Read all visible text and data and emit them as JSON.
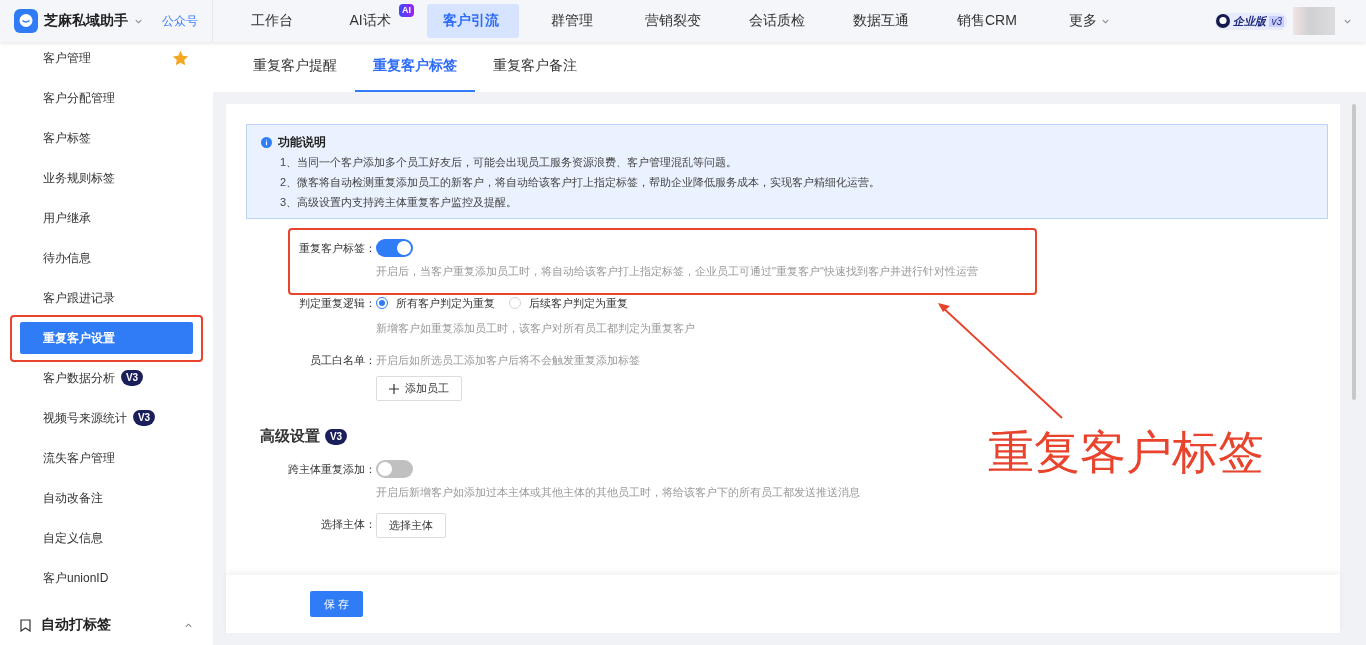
{
  "app": {
    "name": "芝麻私域助手",
    "account_link": "公众号"
  },
  "nav": [
    {
      "label": "工作台",
      "selected": false
    },
    {
      "label": "AI话术",
      "selected": false,
      "badge": "AI"
    },
    {
      "label": "客户引流",
      "selected": true
    },
    {
      "label": "群管理",
      "selected": false
    },
    {
      "label": "营销裂变",
      "selected": false
    },
    {
      "label": "会话质检",
      "selected": false
    },
    {
      "label": "数据互通",
      "selected": false
    },
    {
      "label": "销售CRM",
      "selected": false
    },
    {
      "label": "更多",
      "selected": false,
      "dropdown": true
    }
  ],
  "edition": {
    "label": "企业版",
    "version": "v3"
  },
  "sidebar": {
    "items": [
      {
        "label": "客户管理",
        "selected": false,
        "starred": true
      },
      {
        "label": "客户分配管理",
        "selected": false
      },
      {
        "label": "客户标签",
        "selected": false
      },
      {
        "label": "业务规则标签",
        "selected": false
      },
      {
        "label": "用户继承",
        "selected": false
      },
      {
        "label": "待办信息",
        "selected": false
      },
      {
        "label": "客户跟进记录",
        "selected": false
      },
      {
        "label": "重复客户设置",
        "selected": true
      },
      {
        "label": "客户数据分析",
        "selected": false,
        "badge": "V3"
      },
      {
        "label": "视频号来源统计",
        "selected": false,
        "badge": "V3"
      },
      {
        "label": "流失客户管理",
        "selected": false
      },
      {
        "label": "自动改备注",
        "selected": false
      },
      {
        "label": "自定义信息",
        "selected": false
      },
      {
        "label": "客户unionID",
        "selected": false
      }
    ],
    "group": {
      "label": "自动打标签",
      "expanded": true
    }
  },
  "tabs": [
    {
      "label": "重复客户提醒",
      "selected": false
    },
    {
      "label": "重复客户标签",
      "selected": true
    },
    {
      "label": "重复客户备注",
      "selected": false
    }
  ],
  "notice": {
    "title": "功能说明",
    "lines": [
      "1、当同一个客户添加多个员工好友后，可能会出现员工服务资源浪费、客户管理混乱等问题。",
      "2、微客将自动检测重复添加员工的新客户，将自动给该客户打上指定标签，帮助企业降低服务成本，实现客户精细化运营。",
      "3、高级设置内支持跨主体重复客户监控及提醒。"
    ]
  },
  "form": [
    {
      "kind": "switch",
      "label": "重复客户标签：",
      "on": true,
      "hint": "开启后，当客户重复添加员工时，将自动给该客户打上指定标签，企业员工可通过\"重复客户\"快速找到客户并进行针对性运营",
      "highlighted": true
    },
    {
      "kind": "radio",
      "label": "判定重复逻辑：",
      "options": [
        {
          "label": "所有客户判定为重复",
          "selected": true
        },
        {
          "label": "后续客户判定为重复",
          "selected": false
        }
      ],
      "hint": "新增客户如重复添加员工时，该客户对所有员工都判定为重复客户"
    },
    {
      "kind": "picker",
      "label": "员工白名单：",
      "hint": "开启后如所选员工添加客户后将不会触发重复添加标签",
      "button": "添加员工"
    }
  ],
  "advanced": {
    "title": "高级设置",
    "badge": "V3",
    "rows": [
      {
        "kind": "switch",
        "label": "跨主体重复添加：",
        "on": false,
        "hint": "开启后新增客户如添加过本主体或其他主体的其他员工时，将给该客户下的所有员工都发送推送消息"
      },
      {
        "kind": "button",
        "label": "选择主体：",
        "button": "选择主体"
      }
    ]
  },
  "save_button": "保 存",
  "annotation": {
    "text": "重复客户标签"
  }
}
